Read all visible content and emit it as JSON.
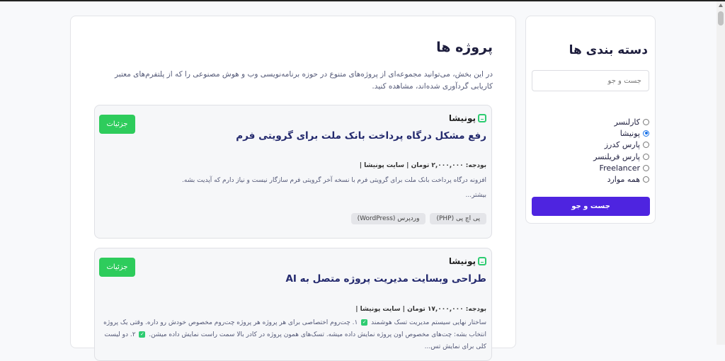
{
  "sidebar": {
    "title": "دسته بندی ها",
    "search_placeholder": "جست و جو",
    "options": [
      {
        "label": "کارلنسر",
        "checked": false
      },
      {
        "label": "پونیشا",
        "checked": true
      },
      {
        "label": "پارس کدرز",
        "checked": false
      },
      {
        "label": "پارس فریلنسر",
        "checked": false
      },
      {
        "label": "Freelancer",
        "checked": false
      },
      {
        "label": "همه موارد",
        "checked": false
      }
    ],
    "search_button": "جست و جو"
  },
  "main": {
    "title": "پروژه ها",
    "intro": "در این بخش، می‌توانید مجموعه‌ای از پروژه‌های متنوع در حوزه برنامه‌نویسی وب و هوش مصنوعی را که از پلتفرم‌های معتبر کاریابی گردآوری شده‌اند، مشاهده کنید."
  },
  "projects": [
    {
      "logo": "پونیشا",
      "details_label": "جزئیات",
      "title": "رفع مشکل درگاه پرداخت بانک ملت برای گرویتی فرم",
      "meta": "بودجه: ۲,۰۰۰,۰۰۰ تومان | سایت پونیشا |",
      "description": "افزونه درگاه پرداخت بانک ملت برای گرویتی فرم با نسخه آخر گرویتی فرم سازگار نیست و نیاز دارم که آپدیت بشه.",
      "more": "بیشتر...",
      "tags": [
        "پی اچ پی (PHP)",
        "وردپرس (WordPress)"
      ]
    },
    {
      "logo": "پونیشا",
      "details_label": "جزئیات",
      "title": "طراحی وبسایت مدیریت پروژه متصل به AI",
      "meta": "بودجه: ۱۷,۰۰۰,۰۰۰ تومان | سایت پونیشا |",
      "description_parts": [
        "ساختار نهایی سیستم مدیریت تسک هوشمند",
        "۱. چت‌روم اختصاصی برای هر پروژه هر پروژه چت‌روم مخصوص خودش رو داره. وقتی یک پروژه انتخاب بشه: چت‌های مخصوص اون پروژه نمایش داده میشه. تسک‌های همون پروژه در کادر بالا سمت راست نمایش داده میشن.",
        "۲. دو لیست کلی برای نمایش تس..."
      ]
    }
  ]
}
